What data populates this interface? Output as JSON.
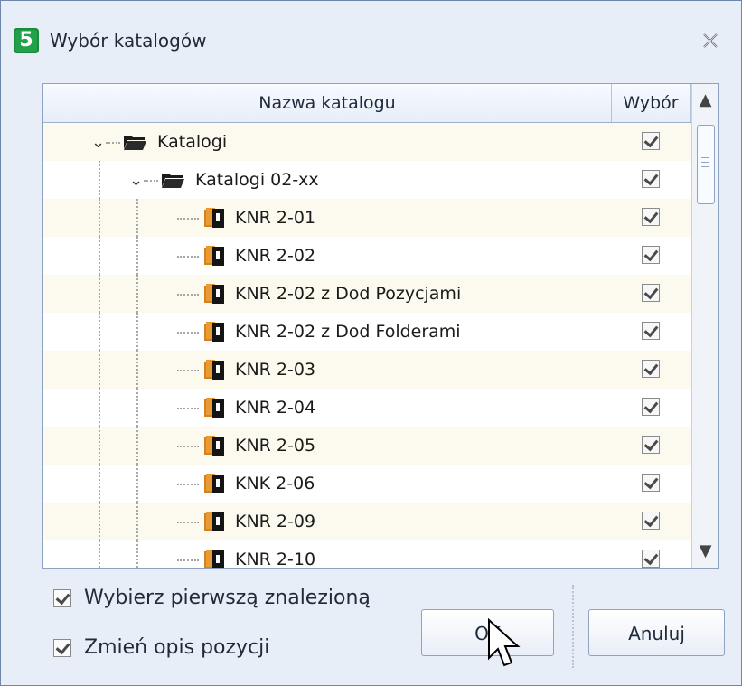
{
  "window": {
    "title": "Wybór katalogów",
    "app_icon_text": "5",
    "close_icon": "close-icon"
  },
  "grid": {
    "headers": [
      "Nazwa katalogu",
      "Wybór"
    ],
    "rows": [
      {
        "label": "Katalogi",
        "level": 0,
        "icon": "folder-icon",
        "checked": true
      },
      {
        "label": "Katalogi 02-xx",
        "level": 1,
        "icon": "folder-icon",
        "checked": true
      },
      {
        "label": "KNR 2-01",
        "level": 2,
        "icon": "book-icon",
        "checked": true
      },
      {
        "label": "KNR 2-02",
        "level": 2,
        "icon": "book-icon",
        "checked": true
      },
      {
        "label": "KNR 2-02 z Dod Pozycjami",
        "level": 2,
        "icon": "book-icon",
        "checked": true
      },
      {
        "label": "KNR 2-02 z Dod Folderami",
        "level": 2,
        "icon": "book-icon",
        "checked": true
      },
      {
        "label": "KNR 2-03",
        "level": 2,
        "icon": "book-icon",
        "checked": true
      },
      {
        "label": "KNR 2-04",
        "level": 2,
        "icon": "book-icon",
        "checked": true
      },
      {
        "label": "KNR 2-05",
        "level": 2,
        "icon": "book-icon",
        "checked": true
      },
      {
        "label": "KNK 2-06",
        "level": 2,
        "icon": "book-icon",
        "checked": true
      },
      {
        "label": "KNR 2-09",
        "level": 2,
        "icon": "book-icon",
        "checked": true
      },
      {
        "label": "KNR 2-10",
        "level": 2,
        "icon": "book-icon",
        "checked": true
      }
    ]
  },
  "options": {
    "first_found_label": "Wybierz pierwszą znalezioną",
    "first_found_checked": true,
    "change_description_label": "Zmień opis pozycji",
    "change_description_checked": true
  },
  "buttons": {
    "ok": "OK",
    "cancel": "Anuluj"
  },
  "colors": {
    "window_bg": "#e8eef7",
    "grid_border": "#8ea3c2",
    "row_alt": "#fcfaef",
    "app_icon": "#22a04a"
  }
}
